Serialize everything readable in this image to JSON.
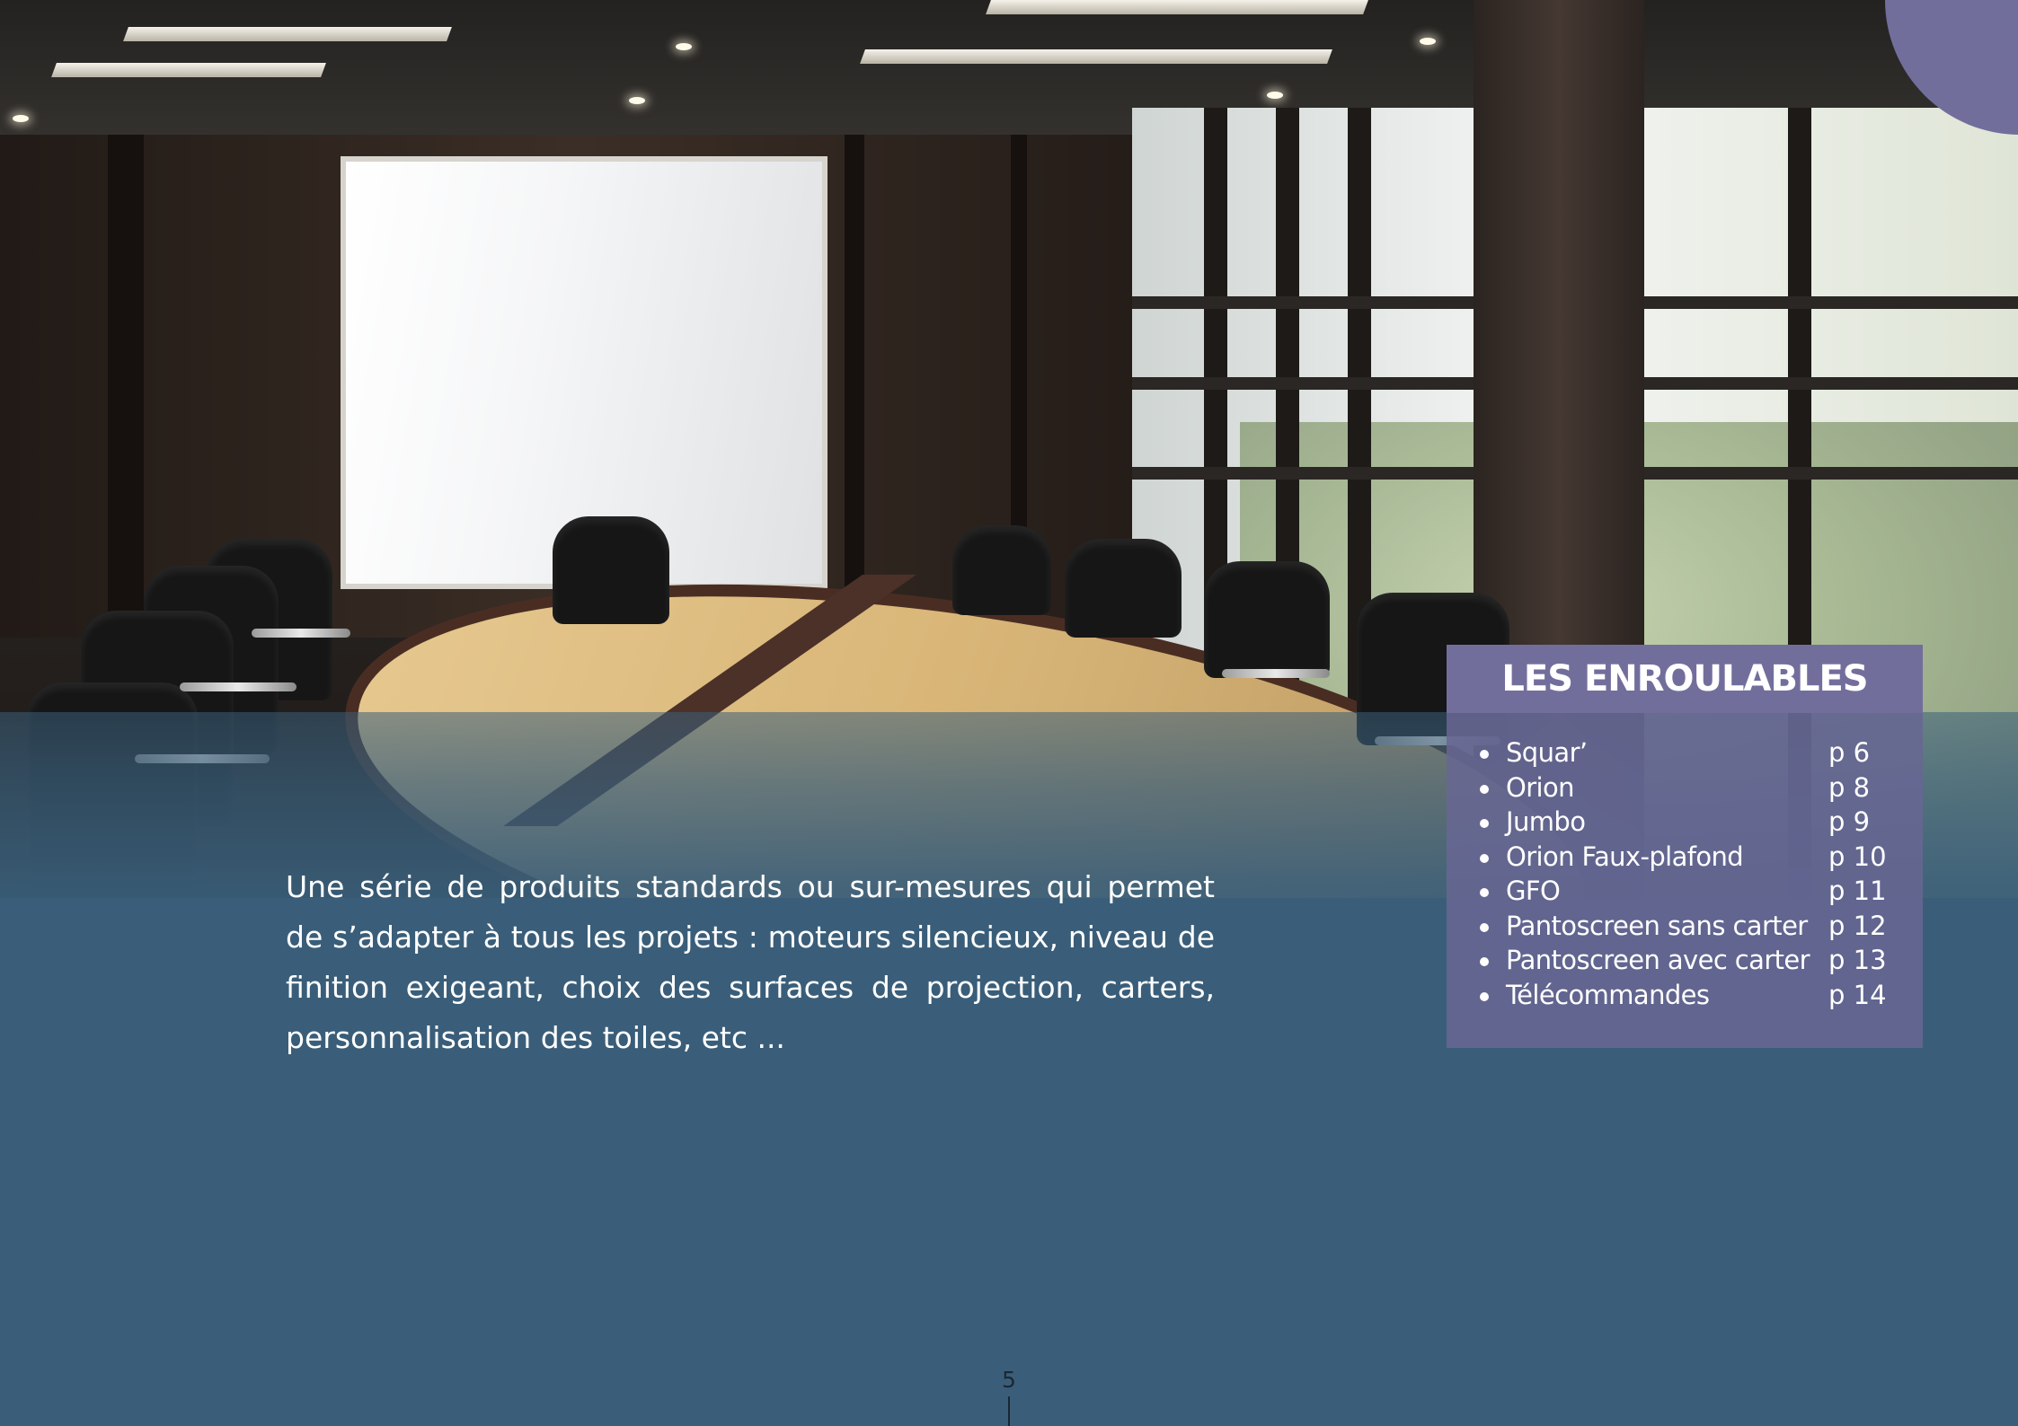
{
  "toc": {
    "title": "LES ENROULABLES",
    "items": [
      {
        "name": "Squar’",
        "page": "p 6"
      },
      {
        "name": "Orion",
        "page": "p 8"
      },
      {
        "name": "Jumbo",
        "page": "p 9"
      },
      {
        "name": "Orion Faux-plafond",
        "page": "p 10"
      },
      {
        "name": "GFO",
        "page": "p 11"
      },
      {
        "name": "Pantoscreen sans carter",
        "page": "p 12"
      },
      {
        "name": "Pantoscreen avec carter",
        "page": "p 13"
      },
      {
        "name": "Télécommandes",
        "page": "p 14"
      }
    ]
  },
  "intro": {
    "text": "Une série de produits standards ou sur-mesures qui permet de s’adapter à tous les projets : moteurs silencieux, niveau de finition exigeant, choix des surfaces de projection, carters, personnalisation des toiles, etc ..."
  },
  "page_number": "5",
  "colors": {
    "background_blue": "#3a5e79",
    "accent_purple": "#726e9c",
    "text_white": "#ffffff"
  }
}
